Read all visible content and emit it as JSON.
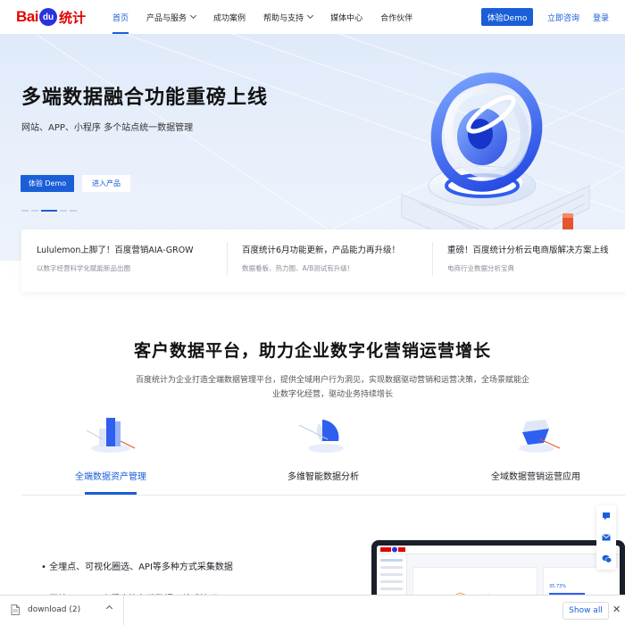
{
  "nav": {
    "logo": {
      "text_bai": "Bai",
      "text_du": "du",
      "text_tongji": "统计"
    },
    "items": [
      {
        "label": "首页",
        "active": true,
        "has_dropdown": false
      },
      {
        "label": "产品与服务",
        "active": false,
        "has_dropdown": true
      },
      {
        "label": "成功案例",
        "active": false,
        "has_dropdown": false
      },
      {
        "label": "帮助与支持",
        "active": false,
        "has_dropdown": true
      },
      {
        "label": "媒体中心",
        "active": false,
        "has_dropdown": false
      },
      {
        "label": "合作伙伴",
        "active": false,
        "has_dropdown": false
      }
    ],
    "demo_button": "体验Demo",
    "consult_button": "立即咨询",
    "login_link": "登录"
  },
  "hero": {
    "title": "多端数据融合功能重磅上线",
    "subtitle": "网站、APP、小程序 多个站点统一数据管理",
    "primary_button": "体验 Demo",
    "secondary_button": "进入产品",
    "carousel_active_index": 2,
    "carousel_count": 5
  },
  "news": [
    {
      "title": "Lululemon上脚了！百度营销AIA-GROW",
      "desc": "以数字经营科学化赋能新品出圈"
    },
    {
      "title": "百度统计6月功能更新，产品能力再升级！",
      "desc": "数据看板、热力图、A/B测试有升级！"
    },
    {
      "title": "重磅！百度统计分析云电商版解决方案上线",
      "desc": "电商行业数据分析宝典"
    }
  ],
  "section": {
    "title": "客户数据平台，助力企业数字化营销运营增长",
    "desc": "百度统计为企业打造全端数据管理平台，提供全域用户行为洞见，实现数据驱动营销和运营决策，全场景赋能企业数字化经营，驱动业务持续增长",
    "features": [
      {
        "label": "全端数据资产管理",
        "icon": "data-asset-icon",
        "active": true
      },
      {
        "label": "多维智能数据分析",
        "icon": "analysis-icon",
        "active": false
      },
      {
        "label": "全域数据营销运营应用",
        "icon": "marketing-icon",
        "active": false
      }
    ],
    "bullets": [
      "• 全埋点、可视化圈选、API等多种方式采集数据",
      "• 网站、APP、小程序等各端数据一站式管理"
    ]
  },
  "laptop_preview": {
    "percent": "35.73%"
  },
  "download_bar": {
    "filename": "download (2)",
    "show_all": "Show all",
    "close": "✕"
  },
  "colors": {
    "brand_blue": "#1a5fd8",
    "baidu_red": "#e10602",
    "baidu_blue": "#2932e1"
  }
}
